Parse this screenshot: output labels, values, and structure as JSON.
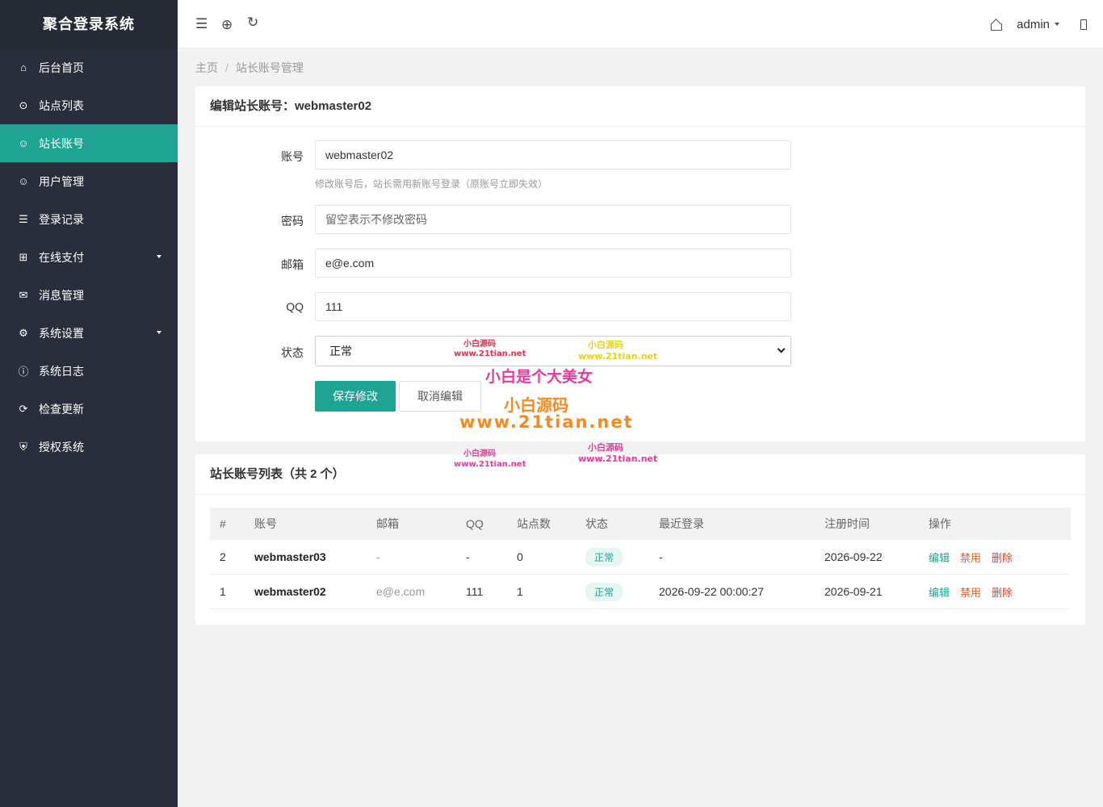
{
  "app": {
    "title": "聚合登录系统"
  },
  "sidebar": {
    "items": [
      {
        "label": "后台首页",
        "icon": "home-icon",
        "active": false,
        "has_children": false
      },
      {
        "label": "站点列表",
        "icon": "circle-icon",
        "active": false,
        "has_children": false
      },
      {
        "label": "站长账号",
        "icon": "smile-icon",
        "active": true,
        "has_children": false
      },
      {
        "label": "用户管理",
        "icon": "smile-icon",
        "active": false,
        "has_children": false
      },
      {
        "label": "登录记录",
        "icon": "list-icon",
        "active": false,
        "has_children": false
      },
      {
        "label": "在线支付",
        "icon": "grid-icon",
        "active": false,
        "has_children": true
      },
      {
        "label": "消息管理",
        "icon": "mail-icon",
        "active": false,
        "has_children": false
      },
      {
        "label": "系统设置",
        "icon": "gear-icon",
        "active": false,
        "has_children": true
      },
      {
        "label": "系统日志",
        "icon": "info-icon",
        "active": false,
        "has_children": false
      },
      {
        "label": "检查更新",
        "icon": "refresh-icon",
        "active": false,
        "has_children": false
      },
      {
        "label": "授权系统",
        "icon": "shield-icon",
        "active": false,
        "has_children": false
      }
    ]
  },
  "header": {
    "user": "admin"
  },
  "breadcrumb": {
    "home": "主页",
    "sep": "/",
    "current": "站长账号管理"
  },
  "edit_form": {
    "title": "编辑站长账号：webmaster02",
    "account_label": "账号",
    "account_value": "webmaster02",
    "account_help": "修改账号后，站长需用新账号登录（原账号立即失效）",
    "password_label": "密码",
    "password_placeholder": "留空表示不修改密码",
    "email_label": "邮箱",
    "email_value": "e@e.com",
    "qq_label": "QQ",
    "qq_value": "111",
    "status_label": "状态",
    "status_value": "正常",
    "save_label": "保存修改",
    "cancel_label": "取消编辑"
  },
  "list": {
    "title": "站长账号列表（共 2 个）",
    "headers": {
      "idx": "#",
      "account": "账号",
      "email": "邮箱",
      "qq": "QQ",
      "sites": "站点数",
      "status": "状态",
      "last_login": "最近登录",
      "registered": "注册时间",
      "ops": "操作"
    },
    "rows": [
      {
        "idx": "2",
        "account": "webmaster03",
        "email": "-",
        "qq": "-",
        "sites": "0",
        "status": "正常",
        "last_login": "-",
        "registered": "2026-09-22",
        "edit": "编辑",
        "ban": "禁用",
        "del": "删除"
      },
      {
        "idx": "1",
        "account": "webmaster02",
        "email": "e@e.com",
        "qq": "111",
        "sites": "1",
        "status": "正常",
        "last_login": "2026-09-22 00:00:27",
        "registered": "2026-09-21",
        "edit": "编辑",
        "ban": "禁用",
        "del": "删除"
      }
    ]
  },
  "watermarks": {
    "w1": "小白源码",
    "w1_url": "www.21tian.net",
    "w2": "小白源码",
    "w2_url": "www.21tian.net",
    "w3": "小白是个大美女",
    "w4": "小白源码",
    "w4_url": "www.21tian.net",
    "w5": "小白源码",
    "w5_url": "www.21tian.net",
    "w6": "小白源码",
    "w6_url": "www.21tian.net"
  }
}
